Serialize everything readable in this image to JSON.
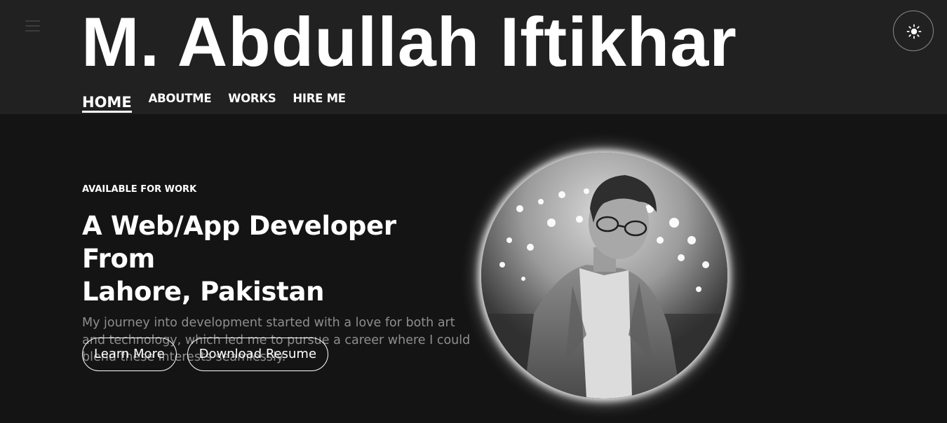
{
  "header": {
    "title": "M. Abdullah Iftikhar",
    "menu_icon": "hamburger-menu-icon",
    "theme_icon": "sun-icon"
  },
  "nav": {
    "items": [
      {
        "label": "HOME",
        "active": true
      },
      {
        "label": "ABOUTME",
        "active": false
      },
      {
        "label": "WORKS",
        "active": false
      },
      {
        "label": "HIRE ME",
        "active": false
      }
    ]
  },
  "hero": {
    "eyebrow": "AVAILABLE FOR WORK",
    "headline_line1": "A Web/App Developer From",
    "headline_line2": "Lahore, Pakistan",
    "description": "My journey into development started with a love for both art and technology, which led me to pursue a career where I could blend these interests seamlessly.",
    "learn_more_label": "Learn More",
    "download_resume_label": "Download Resume"
  },
  "colors": {
    "header_bg": "#212121",
    "page_bg": "#141414",
    "text": "#ffffff",
    "muted_text": "#8e8e8e"
  }
}
